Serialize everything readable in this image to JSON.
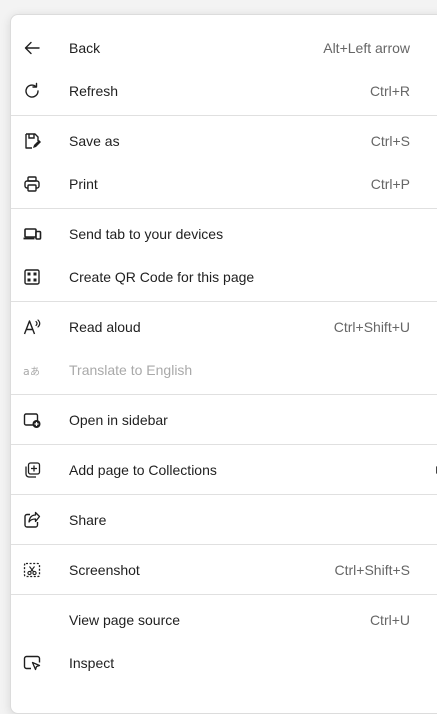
{
  "menu": {
    "items": [
      {
        "label": "Back",
        "shortcut": "Alt+Left arrow",
        "icon": "arrow-left-icon"
      },
      {
        "label": "Refresh",
        "shortcut": "Ctrl+R",
        "icon": "refresh-icon"
      },
      {
        "label": "Save as",
        "shortcut": "Ctrl+S",
        "icon": "save-as-icon"
      },
      {
        "label": "Print",
        "shortcut": "Ctrl+P",
        "icon": "printer-icon"
      },
      {
        "label": "Send tab to your devices",
        "shortcut": "",
        "icon": "devices-icon"
      },
      {
        "label": "Create QR Code for this page",
        "shortcut": "",
        "icon": "qr-code-icon"
      },
      {
        "label": "Read aloud",
        "shortcut": "Ctrl+Shift+U",
        "icon": "read-aloud-icon"
      },
      {
        "label": "Translate to English",
        "shortcut": "",
        "icon": "translate-icon",
        "disabled": true
      },
      {
        "label": "Open in sidebar",
        "shortcut": "",
        "icon": "sidebar-icon"
      },
      {
        "label": "Add page to Collections",
        "shortcut": "",
        "icon": "collections-add-icon",
        "submenu": true
      },
      {
        "label": "Share",
        "shortcut": "",
        "icon": "share-icon"
      },
      {
        "label": "Screenshot",
        "shortcut": "Ctrl+Shift+S",
        "icon": "screenshot-icon"
      },
      {
        "label": "View page source",
        "shortcut": "Ctrl+U",
        "icon": ""
      },
      {
        "label": "Inspect",
        "shortcut": "",
        "icon": "inspect-icon"
      }
    ],
    "colors": {
      "background": "#ffffff",
      "page": "#f3f3f3",
      "text": "#1f1f1f",
      "shortcut": "#666666",
      "disabled": "#a9a9a9",
      "separator": "#e0e0e0"
    }
  }
}
